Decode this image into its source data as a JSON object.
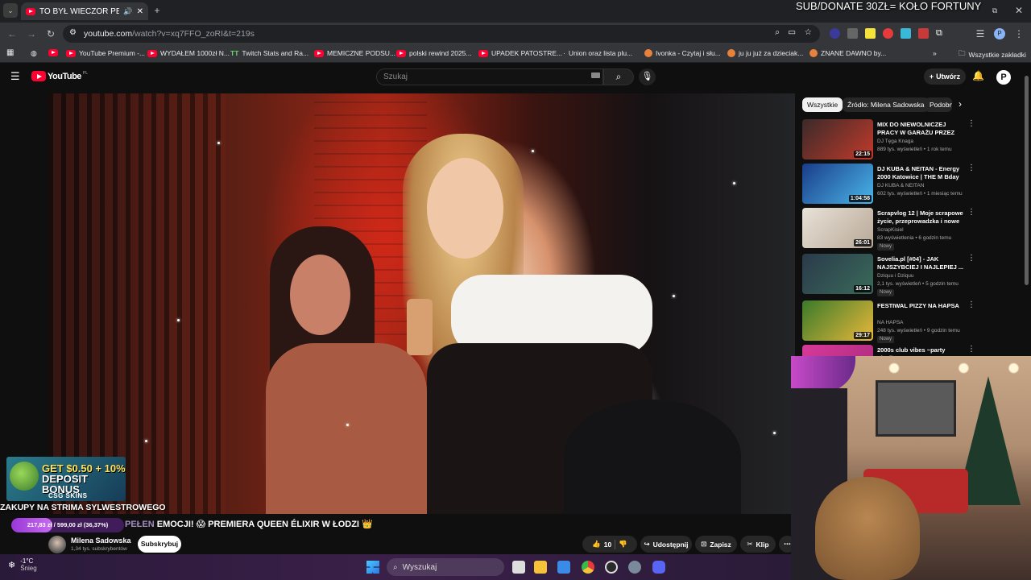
{
  "browser": {
    "tab_title": "TO BYŁ WIECZÓR PEŁEN EMOCJI",
    "url_main": "youtube.com",
    "url_path": "/watch?v=xq7FFO_zoRI&t=219s",
    "bookmarks": [
      {
        "label": "",
        "icon": "yt"
      },
      {
        "label": "YouTube Premium -...",
        "icon": "yt"
      },
      {
        "label": "WYDAŁEM 1000zł N...",
        "icon": "yt"
      },
      {
        "label": "Twitch Stats and Ra...",
        "icon": "tt"
      },
      {
        "label": "MEMICZNE PODSU...",
        "icon": "yt"
      },
      {
        "label": "polski rewind 2025...",
        "icon": "yt"
      },
      {
        "label": "UPADEK PATOSTRE...",
        "icon": "yt"
      },
      {
        "label": "Union oraz lista plu...",
        "icon": "dot"
      },
      {
        "label": "Ivonka - Czytaj i słu...",
        "icon": "circle"
      },
      {
        "label": "ju ju już za dzieciak...",
        "icon": "circle"
      },
      {
        "label": "ZNANE DAWNO by...",
        "icon": "circle"
      }
    ],
    "all_bookmarks": "Wszystkie zakładki"
  },
  "overlay": {
    "top_banner": "SUB/DONATE 30ZŁ= KOŁO FORTUNY",
    "promo_line1": "GET $0.50 + 10%",
    "promo_line2": "DEPOSIT BONUS",
    "promo_brand": "CSG SKINS",
    "ticker": "ZAKUPY NA STRIMA SYLWESTROWEGO",
    "goal_text": "217,83 zł / 599,00 zł (36,37%)",
    "goal_fraction": 0.3637
  },
  "youtube": {
    "logo_text": "YouTube",
    "logo_region": "PL",
    "search_placeholder": "Szukaj",
    "create_label": "Utwórz",
    "avatar_letter": "P",
    "video_title_ghost": "PEŁEN",
    "video_title": "EMOCJI! 😱 PREMIERA QUEEN ÉLIXIR W ŁODZI 👑",
    "channel_name": "Milena Sadowska",
    "subscribers": "1,34 tys. subskrybentów",
    "subscribe_label": "Subskrybuj",
    "like_count": "10",
    "share_label": "Udostępnij",
    "save_label": "Zapisz",
    "clip_label": "Klip",
    "chips": [
      "Wszystkie",
      "Źródło: Milena Sadowska",
      "Podobne"
    ],
    "recommendations": [
      {
        "title": "MIX DO NIEWOLNICZEJ PRACY W GARAŻU PRZEZ 12H ZA ...",
        "channel": "DJ Tęga Knaga",
        "meta": "889 tys. wyświetleń • 1 rok temu",
        "duration": "22:15",
        "badge": "",
        "color1": "#3a2a2a",
        "color2": "#c23a2a"
      },
      {
        "title": "DJ KUBA & NEITAN - Energy 2000 Katowice | THE M Bday ...",
        "channel": "DJ KUBA & NEITAN",
        "meta": "602 tys. wyświetleń • 1 miesiąc temu",
        "duration": "1:04:58",
        "badge": "",
        "color1": "#1a3c8a",
        "color2": "#4ab6e8"
      },
      {
        "title": "Scrapvlog 12 | Moje scrapowe życie, przeprowadzka i nowe ...",
        "channel": "ScrapKisiel",
        "meta": "83 wyświetlenia • 6 godzin temu",
        "duration": "26:01",
        "badge": "Nowy",
        "color1": "#e8e2d8",
        "color2": "#b8a896"
      },
      {
        "title": "Sovelia.pl [#04] - JAK NAJSZYBCIEJ I NAJLEPIEJ ...",
        "channel": "Dziquu i Dziquu",
        "meta": "2,1 tys. wyświetleń • 5 godzin temu",
        "duration": "16:12",
        "badge": "Nowy",
        "color1": "#2a3a4a",
        "color2": "#3a6a5a"
      },
      {
        "title": "FESTIWAL PIZZY NA HAPSA",
        "channel": "NA HAPSA",
        "meta": "248 tys. wyświetleń • 9 godzin temu",
        "duration": "29:17",
        "badge": "Nowy",
        "color1": "#3a7a2a",
        "color2": "#e8b83a"
      },
      {
        "title": "2000s club vibes ~party playlist",
        "channel": "",
        "meta": "",
        "duration": "",
        "badge": "",
        "color1": "#d83a9a",
        "color2": "#a82a7a"
      }
    ]
  },
  "taskbar": {
    "weather_temp": "-1°C",
    "weather_desc": "Śnieg",
    "search_label": "Wyszukaj"
  }
}
